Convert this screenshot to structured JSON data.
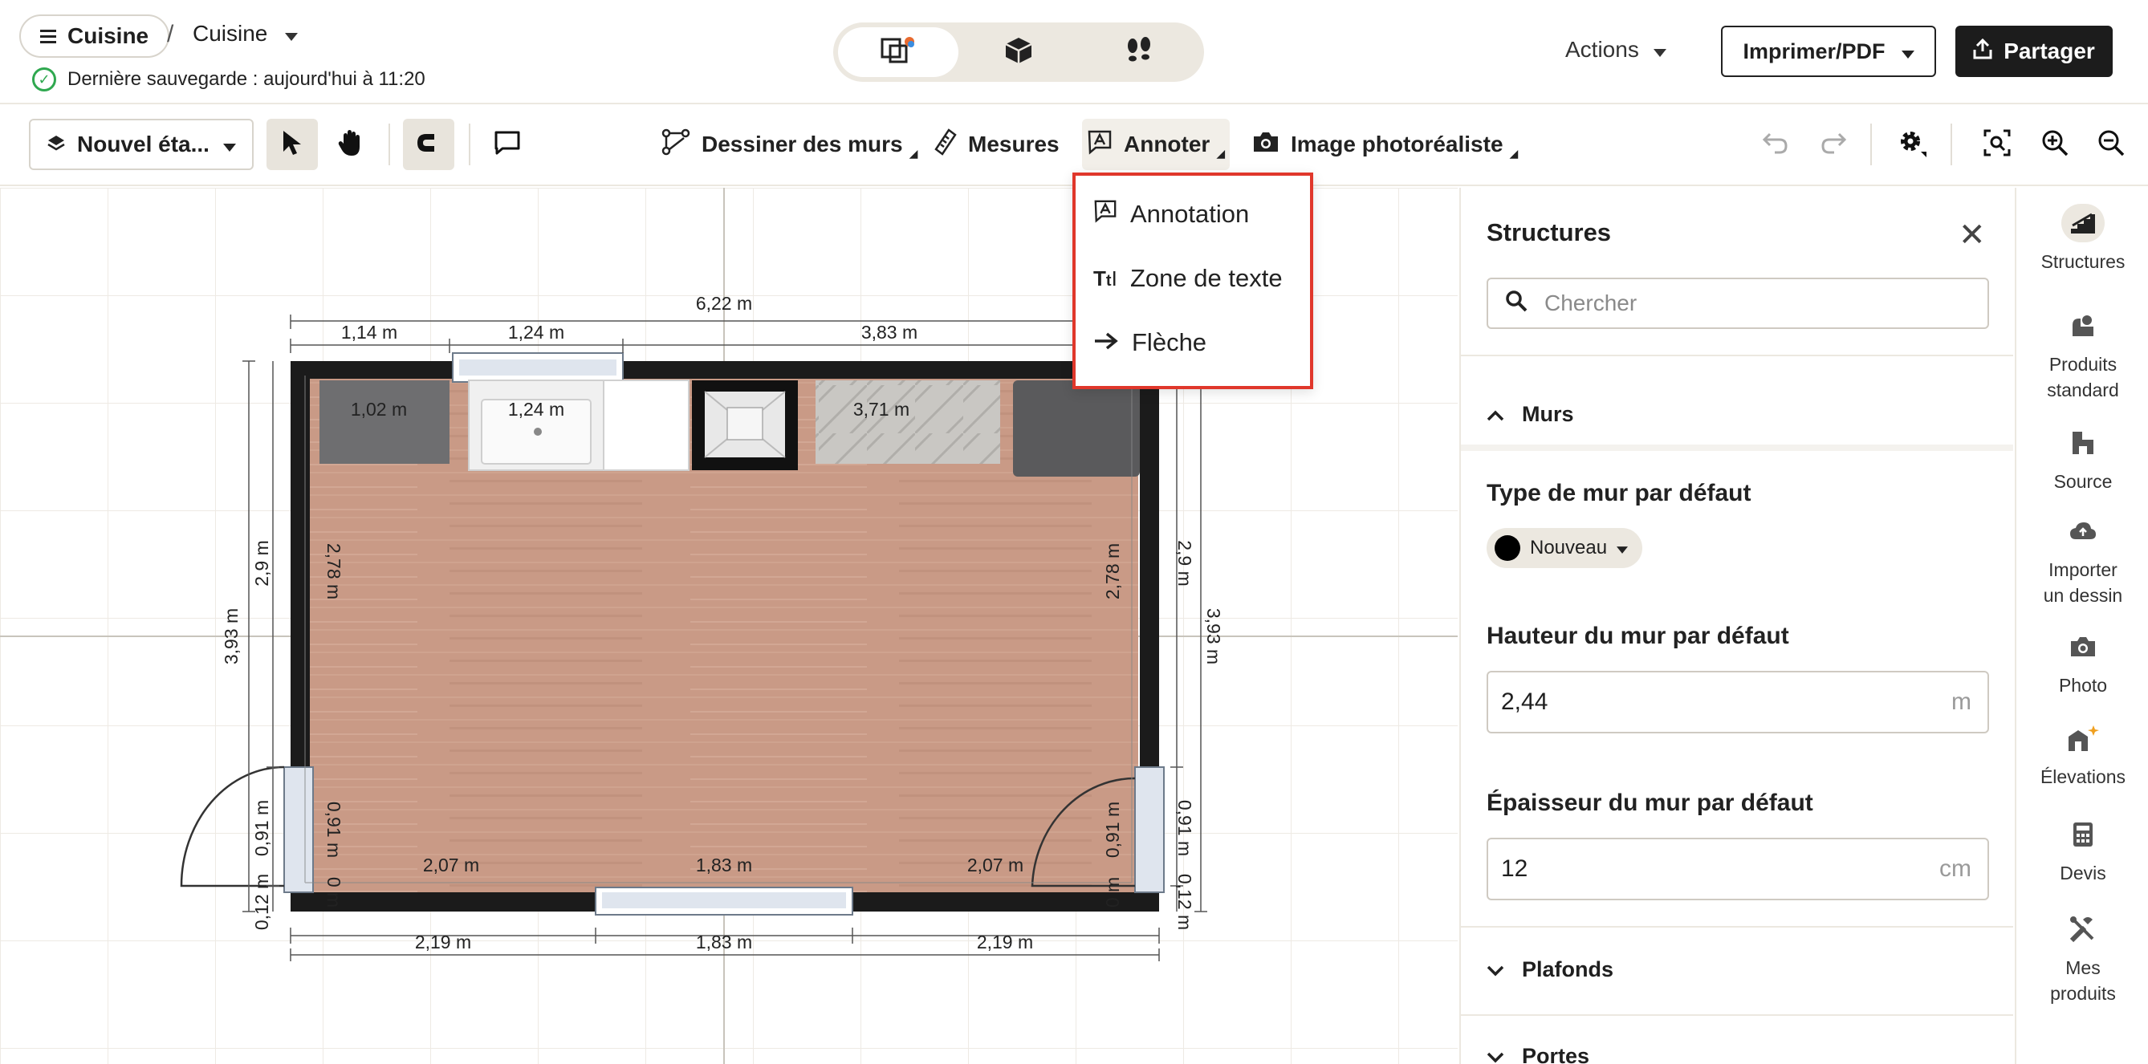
{
  "header": {
    "menu_label": "Cuisine",
    "separator": "/",
    "project_name": "Cuisine",
    "save_status": "Dernière sauvegarde : aujourd'hui à 11:20",
    "actions_label": "Actions",
    "print_label": "Imprimer/PDF",
    "share_label": "Partager"
  },
  "toolbar": {
    "level_label": "Nouvel éta...",
    "draw_walls": "Dessiner des murs",
    "measures": "Mesures",
    "annotate": "Annoter",
    "photoreal": "Image photoréaliste"
  },
  "annotate_menu": {
    "items": [
      "Annotation",
      "Zone de texte",
      "Flèche"
    ]
  },
  "floorplan": {
    "dimensions": {
      "total_top": "6,22 m",
      "top_a": "1,14 m",
      "top_b": "1,24 m",
      "top_c": "3,83 m",
      "inner_a": "1,02 m",
      "inner_b": "1,24 m",
      "inner_c": "3,71 m",
      "left_outer": "3,93 m",
      "left_mid": "2,9 m",
      "left_inner": "2,78 m",
      "left_door": "0,91 m",
      "left_door_inner": "0,91 m",
      "left_small": "0,12 m",
      "left_zero": "0 m",
      "right_outer": "3,93 m",
      "right_mid": "2,9 m",
      "right_inner": "2,78 m",
      "right_door": "0,91 m",
      "right_door_inner": "0,91 m",
      "right_small": "0,12 m",
      "right_zero": "0 m",
      "bottom_inner_a": "2,07 m",
      "bottom_inner_b": "1,83 m",
      "bottom_inner_c": "2,07 m",
      "bottom_a": "2,19 m",
      "bottom_b": "1,83 m",
      "bottom_c": "2,19 m"
    }
  },
  "panel": {
    "title": "Structures",
    "search_placeholder": "Chercher",
    "section_walls": "Murs",
    "wall_type_label": "Type de mur par défaut",
    "wall_type_value": "Nouveau",
    "wall_height_label": "Hauteur du mur par défaut",
    "wall_height_value": "2,44",
    "wall_height_unit": "m",
    "wall_thickness_label": "Épaisseur du mur par défaut",
    "wall_thickness_value": "12",
    "wall_thickness_unit": "cm",
    "section_ceilings": "Plafonds",
    "section_doors": "Portes"
  },
  "rail": {
    "items": [
      {
        "label_1": "Structures",
        "label_2": ""
      },
      {
        "label_1": "Produits",
        "label_2": "standard"
      },
      {
        "label_1": "Source",
        "label_2": ""
      },
      {
        "label_1": "Importer",
        "label_2": "un dessin"
      },
      {
        "label_1": "Photo",
        "label_2": ""
      },
      {
        "label_1": "Élevations",
        "label_2": ""
      },
      {
        "label_1": "Devis",
        "label_2": ""
      },
      {
        "label_1": "Mes",
        "label_2": "produits"
      }
    ]
  },
  "colors": {
    "accent_red": "#e0372b",
    "dark": "#1c1c1c",
    "beige": "#ece8e0",
    "save_green": "#2fa84f",
    "floor": "#c99a86"
  }
}
